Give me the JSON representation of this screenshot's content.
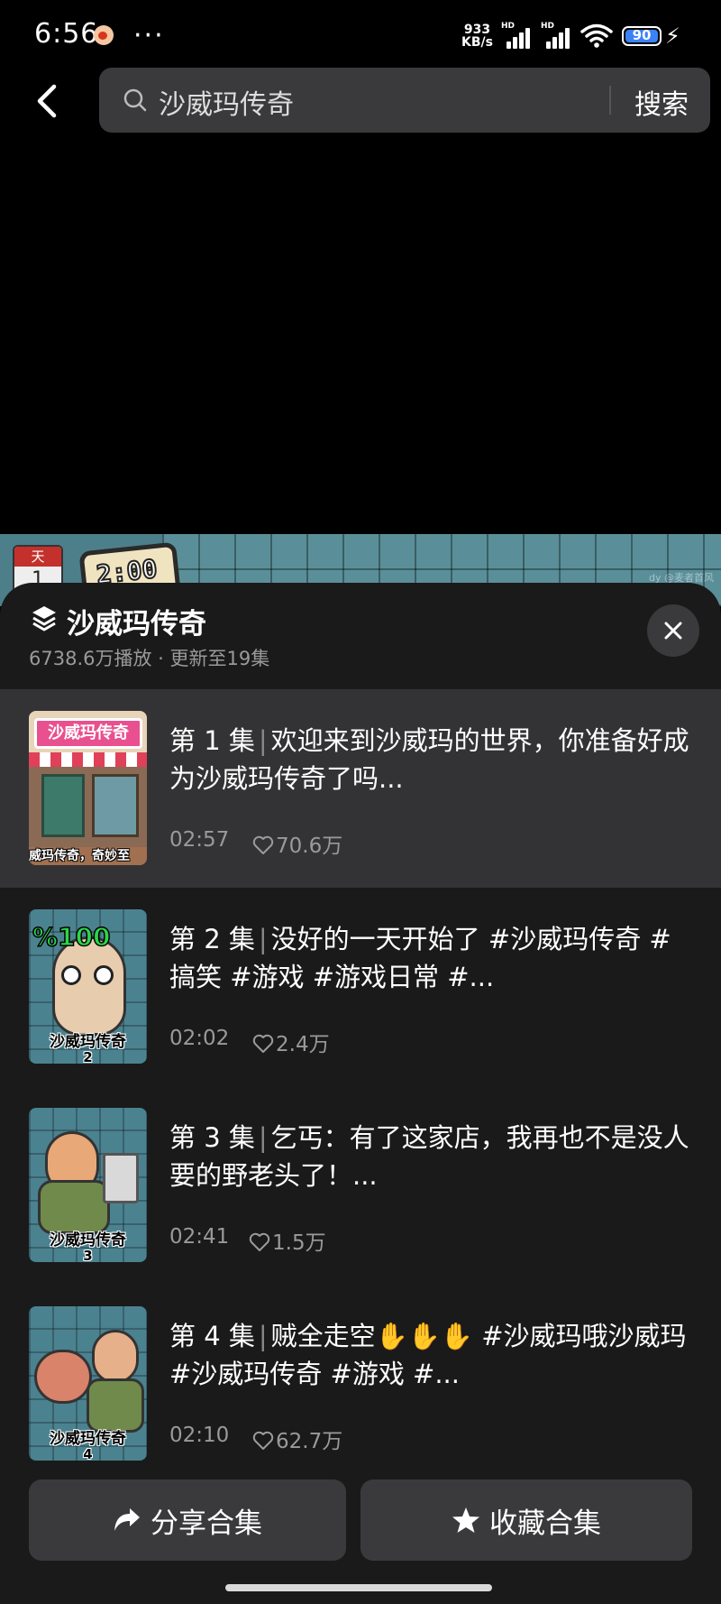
{
  "status_bar": {
    "time": "6:56",
    "net_speed_value": "933",
    "net_speed_unit": "KB/s",
    "hd_label": "HD",
    "battery": "90"
  },
  "search": {
    "query": "沙威玛传奇",
    "button_label": "搜索"
  },
  "video": {
    "calendar_label": "天",
    "calendar_day": "1",
    "clock_text": "2:00",
    "watermark": "dy @麦者首风"
  },
  "collection": {
    "title": "沙威玛传奇",
    "meta": "6738.6万播放 · 更新至19集"
  },
  "episodes": [
    {
      "label": "第 1 集",
      "title": "欢迎来到沙威玛的世界，你准备好成为沙威玛传奇了吗...",
      "duration": "02:57",
      "likes": "70.6万",
      "thumb_caption": "威玛传奇，奇妙至",
      "thumb_sign": "沙威玛传奇",
      "thumb_number": ""
    },
    {
      "label": "第 2 集",
      "title": "没好的一天开始了 #沙威玛传奇 #搞笑 #游戏 #游戏日常 #...",
      "duration": "02:02",
      "likes": "2.4万",
      "thumb_caption": "沙威玛传奇",
      "thumb_sign": "%100",
      "thumb_number": "2"
    },
    {
      "label": "第 3 集",
      "title": "乞丐：有了这家店，我再也不是没人要的野老头了！...",
      "duration": "02:41",
      "likes": "1.5万",
      "thumb_caption": "沙威玛传奇",
      "thumb_sign": "",
      "thumb_number": "3"
    },
    {
      "label": "第 4 集",
      "title": "贼全走空✋✋✋ #沙威玛哦沙威玛 #沙威玛传奇 #游戏 #...",
      "duration": "02:10",
      "likes": "62.7万",
      "thumb_caption": "沙威玛传奇",
      "thumb_sign": "",
      "thumb_number": "4"
    }
  ],
  "actions": {
    "share_label": "分享合集",
    "favorite_label": "收藏合集"
  }
}
